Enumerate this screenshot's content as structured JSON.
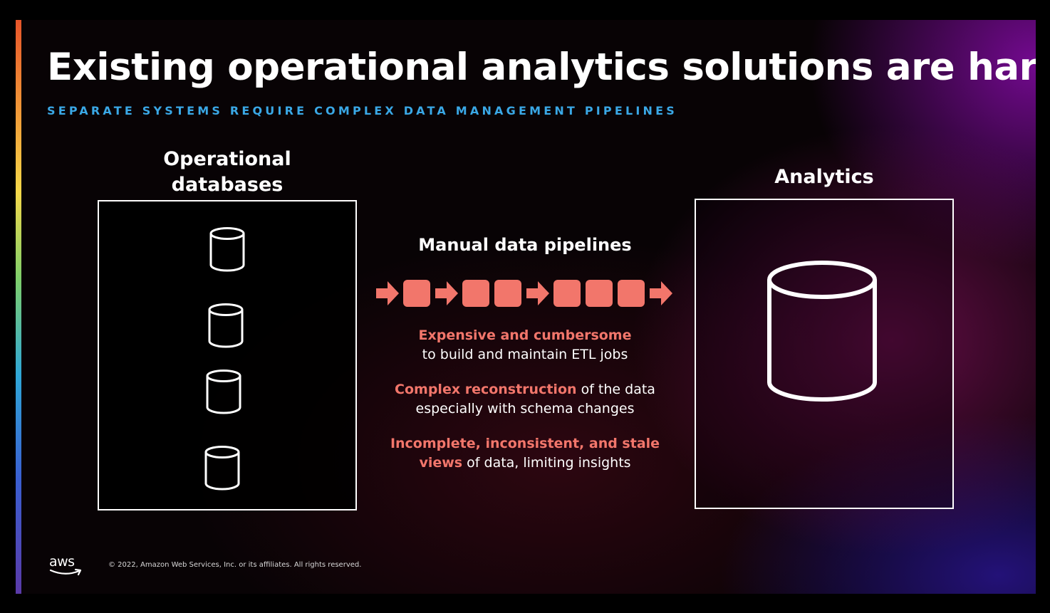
{
  "slide": {
    "title": "Existing operational analytics solutions are hard",
    "subtitle": "SEPARATE SYSTEMS REQUIRE COMPLEX DATA MANAGEMENT PIPELINES"
  },
  "operational": {
    "heading_line1": "Operational",
    "heading_line2": "databases",
    "database_icons": [
      "database-icon",
      "database-icon",
      "database-icon",
      "database-icon"
    ]
  },
  "analytics": {
    "heading": "Analytics",
    "database_icon": "database-icon"
  },
  "pipeline": {
    "heading": "Manual data pipelines",
    "sequence": [
      "arrow",
      "block",
      "arrow",
      "block",
      "block",
      "arrow",
      "block",
      "block",
      "block",
      "arrow"
    ],
    "color": "#f2766b"
  },
  "descriptions": [
    {
      "highlight": "Expensive and cumbersome",
      "rest": "to build and maintain ETL jobs"
    },
    {
      "highlight": "Complex reconstruction",
      "rest_inline": " of the data",
      "rest": "especially with schema changes"
    },
    {
      "highlight_line1": "Incomplete, inconsistent, and stale",
      "highlight_line2": "views",
      "rest": " of data, limiting insights"
    }
  ],
  "footer": {
    "logo_text": "aws",
    "copyright": "© 2022, Amazon Web Services, Inc. or its affiliates. All rights reserved."
  },
  "colors": {
    "accent_text": "#3aa8e6",
    "highlight": "#f2766b",
    "background": "#080305"
  }
}
